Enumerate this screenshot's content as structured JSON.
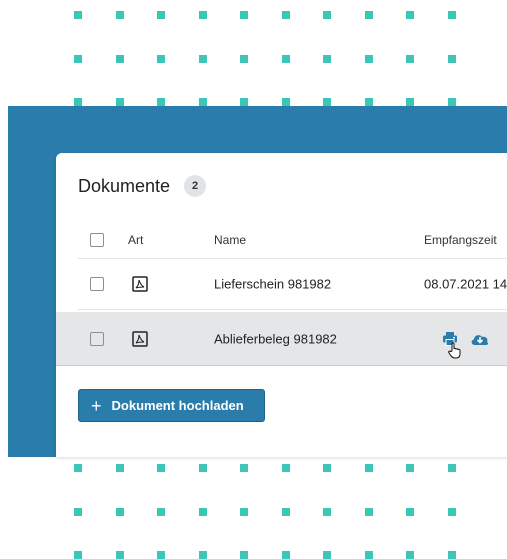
{
  "card": {
    "title": "Dokumente",
    "count": "2"
  },
  "table": {
    "columns": [
      "Art",
      "Name",
      "Empfangszeit"
    ],
    "rows": [
      {
        "type_icon": "pdf-icon",
        "name": "Lieferschein 981982",
        "received": "08.07.2021 14"
      },
      {
        "type_icon": "pdf-icon",
        "name": "Ablieferbeleg 981982",
        "actions": [
          "print-icon",
          "cloud-download-icon"
        ]
      }
    ]
  },
  "upload_button": {
    "label": "Dokument hochladen",
    "icon": "plus-icon"
  },
  "colors": {
    "accent": "#2a7cab",
    "dots": "#3cc6b6",
    "hover_row": "#e4e6e8"
  }
}
